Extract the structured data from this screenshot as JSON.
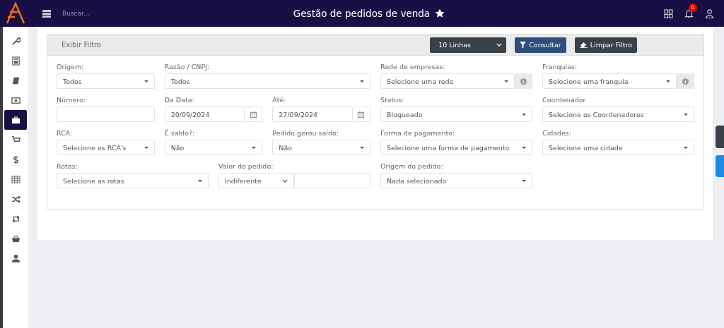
{
  "header": {
    "search": {
      "placeholder": "Buscar..."
    },
    "title": "Gestão de pedidos de venda",
    "favorite": true,
    "notifications": "0"
  },
  "sidebar": {
    "items": [
      {
        "selected": false
      },
      {
        "selected": false
      },
      {
        "selected": false
      },
      {
        "selected": false
      },
      {
        "selected": true
      },
      {
        "selected": false
      },
      {
        "selected": false
      },
      {
        "selected": false
      },
      {
        "selected": false
      },
      {
        "selected": false
      },
      {
        "selected": false
      },
      {
        "selected": false
      }
    ]
  },
  "filter": {
    "title": "Exibir Filtro",
    "page_size": "10 Linhas",
    "buttons": [
      "Consultar",
      "Limpar Filtro"
    ],
    "fields": [
      {
        "label": "Origem:",
        "kind": "select",
        "value": "Todos"
      },
      {
        "label": "Razão / CNPJ:",
        "kind": "select",
        "value": "Todos"
      },
      {
        "label": "Rede de empresas:",
        "kind": "select_info",
        "value": "Selecione uma rede"
      },
      {
        "label": "Franquias:",
        "kind": "select_info",
        "value": "Selecione uma franquia"
      },
      {
        "label": "Número:",
        "kind": "text"
      },
      {
        "label": "Da Data:",
        "kind": "date",
        "value": "20/09/2024"
      },
      {
        "label": "Até:",
        "kind": "date",
        "value": "27/09/2024"
      },
      {
        "label": "Status:",
        "kind": "select",
        "value": "Bloqueado"
      },
      {
        "label": "Coordenador",
        "kind": "select",
        "value": "Selecione os Coordenadores"
      },
      {
        "label": "RCA:",
        "kind": "select",
        "value": "Selecione os RCA's"
      },
      {
        "label": "É saldo?:",
        "kind": "select",
        "value": "Não"
      },
      {
        "label": "Pedido gerou saldo:",
        "kind": "select",
        "value": "Não"
      },
      {
        "label": "Forma de pagamento:",
        "kind": "select",
        "value": "Selecione uma forma de pagamento"
      },
      {
        "label": "Cidades:",
        "kind": "select",
        "value": "Selecione uma cidade"
      },
      {
        "label": "Rotas:",
        "kind": "select",
        "value": "Selecione as rotas"
      },
      {
        "label": "Valor do pedido:",
        "kind": "combo",
        "value": "Indiferente"
      },
      {
        "label": "Origem do pedido:",
        "kind": "select",
        "value": "Nada selecionado"
      }
    ]
  }
}
